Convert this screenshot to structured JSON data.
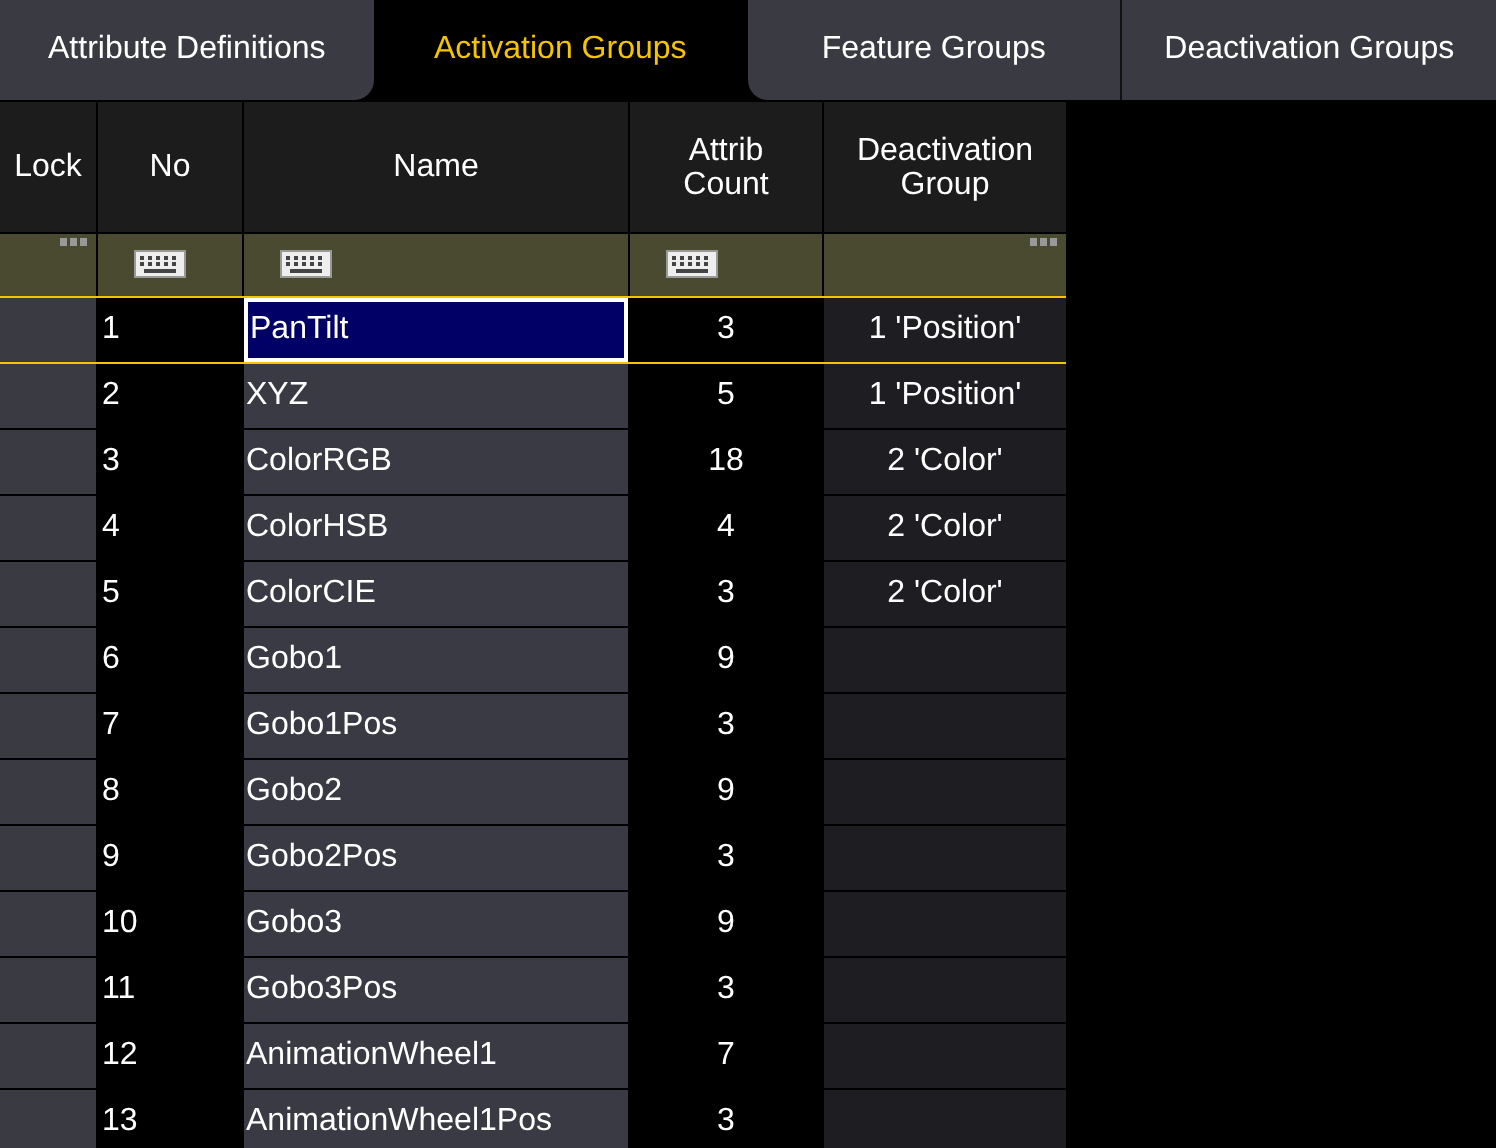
{
  "tabs": [
    {
      "label": "Attribute Definitions",
      "selected": false
    },
    {
      "label": "Activation Groups",
      "selected": true
    },
    {
      "label": "Feature Groups",
      "selected": false
    },
    {
      "label": "Deactivation Groups",
      "selected": false
    }
  ],
  "table": {
    "columns": [
      {
        "label": "Lock",
        "kind": "lock",
        "filter": {
          "kind": "menu"
        }
      },
      {
        "label": "No",
        "kind": "no",
        "filter": {
          "kind": "keyboard"
        }
      },
      {
        "label": "Name",
        "kind": "name",
        "filter": {
          "kind": "keyboard"
        }
      },
      {
        "label": "Attrib\nCount",
        "kind": "count",
        "filter": {
          "kind": "keyboard"
        }
      },
      {
        "label": "Deactivation\nGroup",
        "kind": "deact",
        "filter": {
          "kind": "menu"
        }
      }
    ],
    "rows": [
      {
        "selected": true,
        "cells": [
          "",
          "1",
          "PanTilt",
          "3",
          "1 'Position'"
        ]
      },
      {
        "selected": false,
        "cells": [
          "",
          "2",
          "XYZ",
          "5",
          "1 'Position'"
        ]
      },
      {
        "selected": false,
        "cells": [
          "",
          "3",
          "ColorRGB",
          "18",
          "2 'Color'"
        ]
      },
      {
        "selected": false,
        "cells": [
          "",
          "4",
          "ColorHSB",
          "4",
          "2 'Color'"
        ]
      },
      {
        "selected": false,
        "cells": [
          "",
          "5",
          "ColorCIE",
          "3",
          "2 'Color'"
        ]
      },
      {
        "selected": false,
        "cells": [
          "",
          "6",
          "Gobo1",
          "9",
          ""
        ]
      },
      {
        "selected": false,
        "cells": [
          "",
          "7",
          "Gobo1Pos",
          "3",
          ""
        ]
      },
      {
        "selected": false,
        "cells": [
          "",
          "8",
          "Gobo2",
          "9",
          ""
        ]
      },
      {
        "selected": false,
        "cells": [
          "",
          "9",
          "Gobo2Pos",
          "3",
          ""
        ]
      },
      {
        "selected": false,
        "cells": [
          "",
          "10",
          "Gobo3",
          "9",
          ""
        ]
      },
      {
        "selected": false,
        "cells": [
          "",
          "11",
          "Gobo3Pos",
          "3",
          ""
        ]
      },
      {
        "selected": false,
        "cells": [
          "",
          "12",
          "AnimationWheel1",
          "7",
          ""
        ]
      },
      {
        "selected": false,
        "cells": [
          "",
          "13",
          "AnimationWheel1Pos",
          "3",
          ""
        ]
      }
    ]
  }
}
